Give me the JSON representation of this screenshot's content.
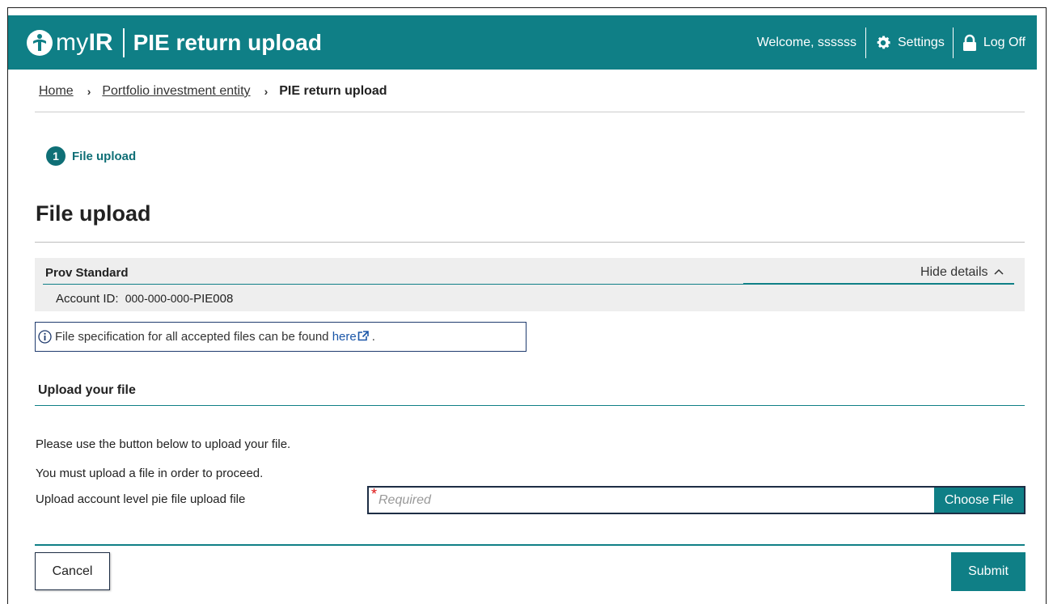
{
  "header": {
    "brand_my": "my",
    "brand_ir": "IR",
    "app_title": "PIE return upload",
    "welcome": "Welcome, ssssss",
    "settings_label": "Settings",
    "logoff_label": "Log Off",
    "color": "#0f7f86"
  },
  "breadcrumb": {
    "home": "Home",
    "portfolio": "Portfolio investment entity",
    "current": "PIE return upload"
  },
  "step": {
    "number": "1",
    "label": "File upload"
  },
  "page_title": "File upload",
  "account": {
    "name": "Prov Standard",
    "hide_details": "Hide details",
    "id_label": "Account ID:",
    "id_value": "000-000-000",
    "id_suffix": "-PIE008"
  },
  "info": {
    "text": "File specification for all accepted files can be found ",
    "link": "here",
    "after": "."
  },
  "upload_section": {
    "title": "Upload your file",
    "instruction": "Please use the button below to upload your file.",
    "requirement": "You must upload a file in order to proceed.",
    "field_label": "Upload account level pie file upload file",
    "required_mark": "*",
    "placeholder": "Required",
    "choose_button": "Choose File"
  },
  "footer": {
    "cancel": "Cancel",
    "submit": "Submit"
  }
}
